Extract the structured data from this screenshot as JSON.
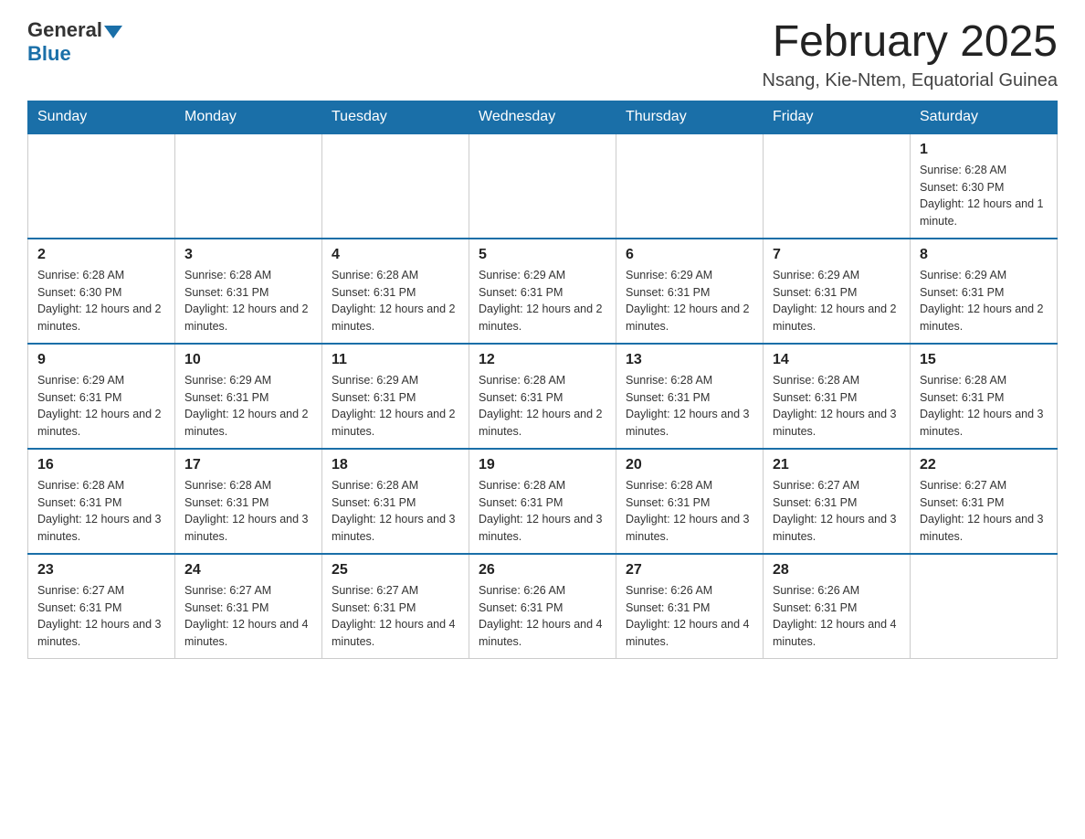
{
  "header": {
    "logo_general": "General",
    "logo_blue": "Blue",
    "title": "February 2025",
    "subtitle": "Nsang, Kie-Ntem, Equatorial Guinea"
  },
  "days_of_week": [
    "Sunday",
    "Monday",
    "Tuesday",
    "Wednesday",
    "Thursday",
    "Friday",
    "Saturday"
  ],
  "weeks": [
    [
      {
        "day": "",
        "info": ""
      },
      {
        "day": "",
        "info": ""
      },
      {
        "day": "",
        "info": ""
      },
      {
        "day": "",
        "info": ""
      },
      {
        "day": "",
        "info": ""
      },
      {
        "day": "",
        "info": ""
      },
      {
        "day": "1",
        "info": "Sunrise: 6:28 AM\nSunset: 6:30 PM\nDaylight: 12 hours and 1 minute."
      }
    ],
    [
      {
        "day": "2",
        "info": "Sunrise: 6:28 AM\nSunset: 6:30 PM\nDaylight: 12 hours and 2 minutes."
      },
      {
        "day": "3",
        "info": "Sunrise: 6:28 AM\nSunset: 6:31 PM\nDaylight: 12 hours and 2 minutes."
      },
      {
        "day": "4",
        "info": "Sunrise: 6:28 AM\nSunset: 6:31 PM\nDaylight: 12 hours and 2 minutes."
      },
      {
        "day": "5",
        "info": "Sunrise: 6:29 AM\nSunset: 6:31 PM\nDaylight: 12 hours and 2 minutes."
      },
      {
        "day": "6",
        "info": "Sunrise: 6:29 AM\nSunset: 6:31 PM\nDaylight: 12 hours and 2 minutes."
      },
      {
        "day": "7",
        "info": "Sunrise: 6:29 AM\nSunset: 6:31 PM\nDaylight: 12 hours and 2 minutes."
      },
      {
        "day": "8",
        "info": "Sunrise: 6:29 AM\nSunset: 6:31 PM\nDaylight: 12 hours and 2 minutes."
      }
    ],
    [
      {
        "day": "9",
        "info": "Sunrise: 6:29 AM\nSunset: 6:31 PM\nDaylight: 12 hours and 2 minutes."
      },
      {
        "day": "10",
        "info": "Sunrise: 6:29 AM\nSunset: 6:31 PM\nDaylight: 12 hours and 2 minutes."
      },
      {
        "day": "11",
        "info": "Sunrise: 6:29 AM\nSunset: 6:31 PM\nDaylight: 12 hours and 2 minutes."
      },
      {
        "day": "12",
        "info": "Sunrise: 6:28 AM\nSunset: 6:31 PM\nDaylight: 12 hours and 2 minutes."
      },
      {
        "day": "13",
        "info": "Sunrise: 6:28 AM\nSunset: 6:31 PM\nDaylight: 12 hours and 3 minutes."
      },
      {
        "day": "14",
        "info": "Sunrise: 6:28 AM\nSunset: 6:31 PM\nDaylight: 12 hours and 3 minutes."
      },
      {
        "day": "15",
        "info": "Sunrise: 6:28 AM\nSunset: 6:31 PM\nDaylight: 12 hours and 3 minutes."
      }
    ],
    [
      {
        "day": "16",
        "info": "Sunrise: 6:28 AM\nSunset: 6:31 PM\nDaylight: 12 hours and 3 minutes."
      },
      {
        "day": "17",
        "info": "Sunrise: 6:28 AM\nSunset: 6:31 PM\nDaylight: 12 hours and 3 minutes."
      },
      {
        "day": "18",
        "info": "Sunrise: 6:28 AM\nSunset: 6:31 PM\nDaylight: 12 hours and 3 minutes."
      },
      {
        "day": "19",
        "info": "Sunrise: 6:28 AM\nSunset: 6:31 PM\nDaylight: 12 hours and 3 minutes."
      },
      {
        "day": "20",
        "info": "Sunrise: 6:28 AM\nSunset: 6:31 PM\nDaylight: 12 hours and 3 minutes."
      },
      {
        "day": "21",
        "info": "Sunrise: 6:27 AM\nSunset: 6:31 PM\nDaylight: 12 hours and 3 minutes."
      },
      {
        "day": "22",
        "info": "Sunrise: 6:27 AM\nSunset: 6:31 PM\nDaylight: 12 hours and 3 minutes."
      }
    ],
    [
      {
        "day": "23",
        "info": "Sunrise: 6:27 AM\nSunset: 6:31 PM\nDaylight: 12 hours and 3 minutes."
      },
      {
        "day": "24",
        "info": "Sunrise: 6:27 AM\nSunset: 6:31 PM\nDaylight: 12 hours and 4 minutes."
      },
      {
        "day": "25",
        "info": "Sunrise: 6:27 AM\nSunset: 6:31 PM\nDaylight: 12 hours and 4 minutes."
      },
      {
        "day": "26",
        "info": "Sunrise: 6:26 AM\nSunset: 6:31 PM\nDaylight: 12 hours and 4 minutes."
      },
      {
        "day": "27",
        "info": "Sunrise: 6:26 AM\nSunset: 6:31 PM\nDaylight: 12 hours and 4 minutes."
      },
      {
        "day": "28",
        "info": "Sunrise: 6:26 AM\nSunset: 6:31 PM\nDaylight: 12 hours and 4 minutes."
      },
      {
        "day": "",
        "info": ""
      }
    ]
  ]
}
